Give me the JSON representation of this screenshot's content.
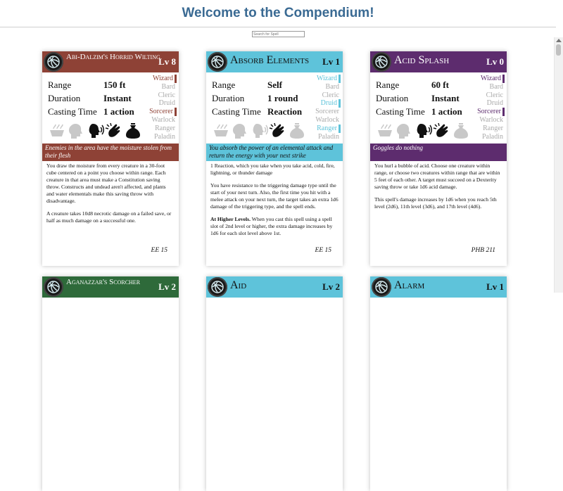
{
  "page": {
    "title": "Welcome to the Compendium!"
  },
  "search": {
    "placeholder": "Search for Spell"
  },
  "labels": {
    "range": "Range",
    "duration": "Duration",
    "casting_time": "Casting Time",
    "at_higher_levels": "At Higher Levels."
  },
  "classes_list": [
    "Wizard",
    "Bard",
    "Cleric",
    "Druid",
    "Sorcerer",
    "Warlock",
    "Ranger",
    "Paladin"
  ],
  "cards": [
    {
      "name": "Abi-Dalzim's Horrid Wilting",
      "level": "Lv 8",
      "color": "#8e4236",
      "range": "150 ft",
      "duration": "Instant",
      "casting_time": "1 action",
      "active_classes": [
        "Wizard",
        "Sorcerer"
      ],
      "components": {
        "ritual": false,
        "concentration": false,
        "verbal": true,
        "somatic": true,
        "material": true
      },
      "flavor": "Enemies in the area have the moisture stolen from their flesh",
      "body": [
        "You draw the moisture from every creature in a 30-foot cube centered on a point you choose within range. Each creature in that area must make a Constitution saving throw. Constructs and undead aren't affected, and plants and water elementals make this saving throw with disadvantage.",
        "A creature takes 10d8 necrotic damage on a failed save, or half as much damage on a successful one."
      ],
      "higher_levels": "",
      "source": "EE 15"
    },
    {
      "name": "Absorb Elements",
      "level": "Lv 1",
      "color": "#5ec3da",
      "range": "Self",
      "duration": "1 round",
      "casting_time": "Reaction",
      "active_classes": [
        "Wizard",
        "Druid",
        "Ranger"
      ],
      "components": {
        "ritual": false,
        "concentration": false,
        "verbal": false,
        "somatic": true,
        "material": false
      },
      "flavor": "You absorb the power of an elemental attack and return the energy with your next strike",
      "body": [
        "1 Reaction, which you take when you take acid, cold, fire, lightning, or thunder damage",
        "You have resistance to the triggering damage type until the start of your next turn. Also, the first time you hit with a melee attack on your next turn, the target takes an extra 1d6 damage of the triggering type, and the spell ends."
      ],
      "higher_levels": "When you cast this spell using a spell slot of 2nd level or higher, the extra damage increases by 1d6 for each slot level above 1st.",
      "source": "EE 15"
    },
    {
      "name": "Acid Splash",
      "level": "Lv 0",
      "color": "#5d2c6e",
      "range": "60 ft",
      "duration": "Instant",
      "casting_time": "1 action",
      "active_classes": [
        "Wizard",
        "Sorcerer"
      ],
      "components": {
        "ritual": false,
        "concentration": false,
        "verbal": true,
        "somatic": true,
        "material": false
      },
      "flavor": "Goggles do nothing",
      "body": [
        "You hurl a bubble of acid. Choose one creature within range, or choose two creatures within range that are within 5 feet of each other. A target must succeed on a Dexterity saving throw or take 1d6 acid damage.",
        "This spell's damage increases by 1d6 when you reach 5th level (2d6), 11th level (3d6), and 17th level (4d6)."
      ],
      "higher_levels": "",
      "source": "PHB 211"
    },
    {
      "name": "Aganazzar's Scorcher",
      "level": "Lv 2",
      "color": "#2e6a3a"
    },
    {
      "name": "Aid",
      "level": "Lv 2",
      "color": "#5ec3da"
    },
    {
      "name": "Alarm",
      "level": "Lv 1",
      "color": "#5ec3da"
    }
  ]
}
